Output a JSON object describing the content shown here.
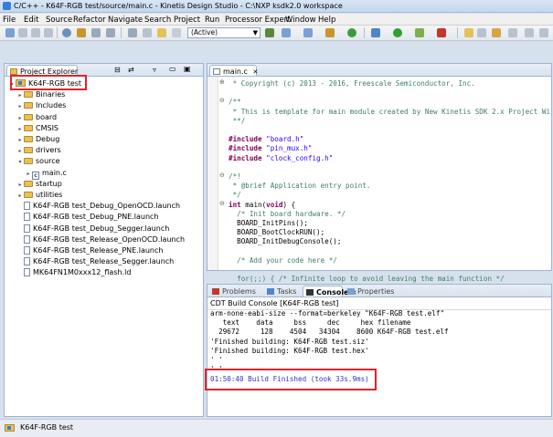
{
  "window": {
    "title": "C/C++ - K64F-RGB test/source/main.c - Kinetis Design Studio - C:\\NXP ksdk2.0 workspace"
  },
  "menu": [
    "File",
    "Edit",
    "Source",
    "Refactor",
    "Navigate",
    "Search",
    "Project",
    "Run",
    "Processor Expert",
    "Window",
    "Help"
  ],
  "toolbar": {
    "config_value": "(Active)"
  },
  "project_explorer": {
    "tab_label": "Project Explorer",
    "items": [
      {
        "label": "K64F-RGB test",
        "type": "project",
        "twisty": "▾",
        "indent": 0
      },
      {
        "label": "Binaries",
        "type": "folder",
        "twisty": "▸",
        "indent": 1
      },
      {
        "label": "Includes",
        "type": "folder",
        "twisty": "▸",
        "indent": 1
      },
      {
        "label": "board",
        "type": "folder",
        "twisty": "▸",
        "indent": 1
      },
      {
        "label": "CMSIS",
        "type": "folder",
        "twisty": "▸",
        "indent": 1
      },
      {
        "label": "Debug",
        "type": "folder",
        "twisty": "▸",
        "indent": 1
      },
      {
        "label": "drivers",
        "type": "folder",
        "twisty": "▸",
        "indent": 1
      },
      {
        "label": "source",
        "type": "folder",
        "twisty": "▾",
        "indent": 1
      },
      {
        "label": "main.c",
        "type": "cfile",
        "twisty": "▸",
        "indent": 2
      },
      {
        "label": "startup",
        "type": "folder",
        "twisty": "▸",
        "indent": 1
      },
      {
        "label": "utilities",
        "type": "folder",
        "twisty": "▸",
        "indent": 1
      },
      {
        "label": "K64F-RGB test_Debug_OpenOCD.launch",
        "type": "file",
        "twisty": "",
        "indent": 1
      },
      {
        "label": "K64F-RGB test_Debug_PNE.launch",
        "type": "file",
        "twisty": "",
        "indent": 1
      },
      {
        "label": "K64F-RGB test_Debug_Segger.launch",
        "type": "file",
        "twisty": "",
        "indent": 1
      },
      {
        "label": "K64F-RGB test_Release_OpenOCD.launch",
        "type": "file",
        "twisty": "",
        "indent": 1
      },
      {
        "label": "K64F-RGB test_Release_PNE.launch",
        "type": "file",
        "twisty": "",
        "indent": 1
      },
      {
        "label": "K64F-RGB test_Release_Segger.launch",
        "type": "file",
        "twisty": "",
        "indent": 1
      },
      {
        "label": "MK64FN1M0xxx12_flash.ld",
        "type": "file",
        "twisty": "",
        "indent": 1
      }
    ]
  },
  "editor": {
    "tab_label": "main.c",
    "lines": [
      {
        "fold": "⊕",
        "segments": [
          {
            "t": " * Copyright (c) 2013 - 2016, Freescale Semiconductor, Inc.",
            "c": "c-comment"
          }
        ]
      },
      {
        "fold": "",
        "segments": []
      },
      {
        "fold": "⊖",
        "segments": [
          {
            "t": "/**",
            "c": "c-comment"
          }
        ]
      },
      {
        "fold": "",
        "segments": [
          {
            "t": " * This is template for main module created by New Kinetis SDK 2.x Project Wi",
            "c": "c-comment"
          }
        ]
      },
      {
        "fold": "",
        "segments": [
          {
            "t": " **/",
            "c": "c-comment"
          }
        ]
      },
      {
        "fold": "",
        "segments": []
      },
      {
        "fold": "",
        "segments": [
          {
            "t": "#include ",
            "c": "c-kw"
          },
          {
            "t": "\"board.h\"",
            "c": "c-str"
          }
        ]
      },
      {
        "fold": "",
        "segments": [
          {
            "t": "#include ",
            "c": "c-kw"
          },
          {
            "t": "\"pin_mux.h\"",
            "c": "c-str"
          }
        ]
      },
      {
        "fold": "",
        "segments": [
          {
            "t": "#include ",
            "c": "c-kw"
          },
          {
            "t": "\"clock_config.h\"",
            "c": "c-str"
          }
        ]
      },
      {
        "fold": "",
        "segments": []
      },
      {
        "fold": "⊖",
        "segments": [
          {
            "t": "/*!",
            "c": "c-comment"
          }
        ]
      },
      {
        "fold": "",
        "segments": [
          {
            "t": " * @brief Application entry point.",
            "c": "c-comment"
          }
        ]
      },
      {
        "fold": "",
        "segments": [
          {
            "t": " */",
            "c": "c-comment"
          }
        ]
      },
      {
        "fold": "⊖",
        "segments": [
          {
            "t": "int ",
            "c": "c-kw"
          },
          {
            "t": "main",
            "c": "c-plain"
          },
          {
            "t": "(",
            "c": "c-plain"
          },
          {
            "t": "void",
            "c": "c-kw"
          },
          {
            "t": ") {",
            "c": "c-plain"
          }
        ]
      },
      {
        "fold": "",
        "segments": [
          {
            "t": "  /* Init board hardware. */",
            "c": "c-comment"
          }
        ]
      },
      {
        "fold": "",
        "segments": [
          {
            "t": "  BOARD_InitPins();",
            "c": "c-plain"
          }
        ]
      },
      {
        "fold": "",
        "segments": [
          {
            "t": "  BOARD_BootClockRUN();",
            "c": "c-plain"
          }
        ]
      },
      {
        "fold": "",
        "segments": [
          {
            "t": "  BOARD_InitDebugConsole();",
            "c": "c-plain"
          }
        ]
      },
      {
        "fold": "",
        "segments": []
      },
      {
        "fold": "",
        "segments": [
          {
            "t": "  /* Add your code here */",
            "c": "c-comment"
          }
        ]
      },
      {
        "fold": "",
        "segments": []
      },
      {
        "fold": "",
        "segments": [
          {
            "t": "  for(;;) { /* Infinite loop to avoid leaving the main function */",
            "c": "c-comment"
          }
        ]
      }
    ]
  },
  "bottom_panel": {
    "tabs": [
      "Problems",
      "Tasks",
      "Console",
      "Properties"
    ],
    "console_title": "CDT Build Console [K64F-RGB test]",
    "lines": [
      "arm-none-eabi-size --format=berkeley \"K64F-RGB test.elf\"",
      "   text    data     bss     dec     hex filename",
      "  29672     128    4504   34304    8600 K64F-RGB test.elf",
      "'Finished building: K64F-RGB test.siz'",
      "'Finished building: K64F-RGB test.hex'",
      "' '",
      "' '",
      "",
      "01:50:40 Build Finished (took 33s.9ms)"
    ]
  },
  "status_bar": {
    "label": "K64F-RGB test"
  },
  "colors": {
    "highlight": "#e0232d",
    "build_finished": "#2b35c9"
  }
}
